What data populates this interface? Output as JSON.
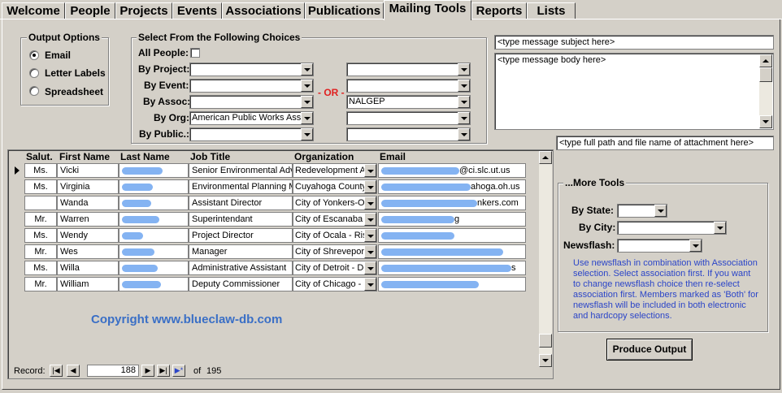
{
  "tabs": [
    "Welcome",
    "People",
    "Projects",
    "Events",
    "Associations",
    "Publications",
    "Mailing Tools",
    "Reports",
    "Lists"
  ],
  "active_tab": "Mailing Tools",
  "output_options": {
    "title": "Output Options",
    "options": [
      "Email",
      "Letter Labels",
      "Spreadsheet"
    ],
    "selected": "Email"
  },
  "choices": {
    "title": "Select From the Following Choices",
    "all_people": "All People:",
    "or_label": "- OR -",
    "rows": [
      {
        "label": "By Project:",
        "left": "",
        "right": ""
      },
      {
        "label": "By Event:",
        "left": "",
        "right": ""
      },
      {
        "label": "By Assoc:",
        "left": "",
        "right": "NALGEP"
      },
      {
        "label": "By Org:",
        "left": "American Public Works Assoc",
        "right": ""
      },
      {
        "label": "By Public.:",
        "left": "",
        "right": ""
      }
    ]
  },
  "message": {
    "subject": "<type message subject here>",
    "body": "<type message body here>",
    "attachment": "<type full path and file name of attachment here>"
  },
  "grid": {
    "headers": [
      "Salut.",
      "First Name",
      "Last Name",
      "Job Title",
      "Organization",
      "Email"
    ],
    "rows": [
      {
        "salut": "Ms.",
        "first": "Vicki",
        "title": "Senior Environmental Adv",
        "org": "Redevelopment A",
        "email": "@ci.slc.ut.us"
      },
      {
        "salut": "Ms.",
        "first": "Virginia",
        "title": "Environmental Planning M",
        "org": "Cuyahoga County",
        "email": "ahoga.oh.us"
      },
      {
        "salut": "",
        "first": "Wanda",
        "title": "Assistant Director",
        "org": "City of Yonkers-Of",
        "email": "nkers.com"
      },
      {
        "salut": "Mr.",
        "first": "Warren",
        "title": "Superintendant",
        "org": "City of Escanaba",
        "email": "g"
      },
      {
        "salut": "Ms.",
        "first": "Wendy",
        "title": "Project Director",
        "org": "City of Ocala - Ris",
        "email": ""
      },
      {
        "salut": "Mr.",
        "first": "Wes",
        "title": "Manager",
        "org": "City of Shreveport",
        "email": ""
      },
      {
        "salut": "Ms.",
        "first": "Willa",
        "title": "Administrative Assistant",
        "org": "City of Detroit - De",
        "email": "s"
      },
      {
        "salut": "Mr.",
        "first": "William",
        "title": "Deputy Commissioner",
        "org": "City of Chicago - D",
        "email": ""
      }
    ],
    "copyright": "Copyright www.blueclaw-db.com"
  },
  "nav": {
    "record_label": "Record:",
    "current": "188",
    "of_label": "of",
    "total": "195"
  },
  "more_tools": {
    "title": "...More Tools",
    "by_state": "By State:",
    "by_city": "By City:",
    "newsflash": "Newsflash:",
    "help": "Use newsflash in combination with Association selection.  Select association first.  If you want to change newsflash choice then re-select association first.  Members marked as 'Both' for newsflash will be included in both electronic and hardcopy selections.",
    "produce_button": "Produce Output"
  }
}
